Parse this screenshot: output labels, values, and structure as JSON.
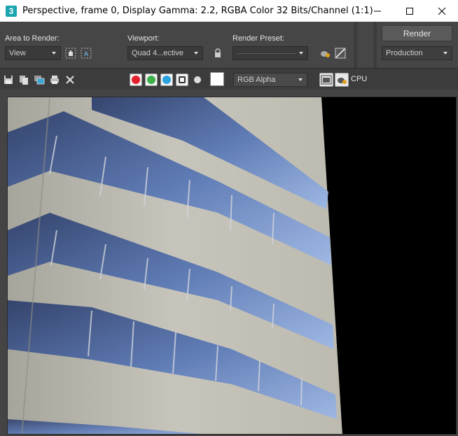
{
  "window": {
    "app_icon_letter": "3",
    "title": "Perspective, frame 0, Display Gamma: 2.2, RGBA Color 32 Bits/Channel (1:1)"
  },
  "panel": {
    "area_label": "Area to Render:",
    "area_value": "View",
    "viewport_label": "Viewport:",
    "viewport_value": "Quad 4...ective",
    "preset_label": "Render Preset:",
    "preset_value": "",
    "render_button": "Render",
    "production_value": "Production"
  },
  "toolbar": {
    "channel_display": "RGB Alpha",
    "renderer": "CPU"
  },
  "colors": {
    "red": "#e3202a",
    "green": "#3cb04a",
    "blue": "#2aa3e0",
    "accent_teal": "#1aa5b0"
  }
}
